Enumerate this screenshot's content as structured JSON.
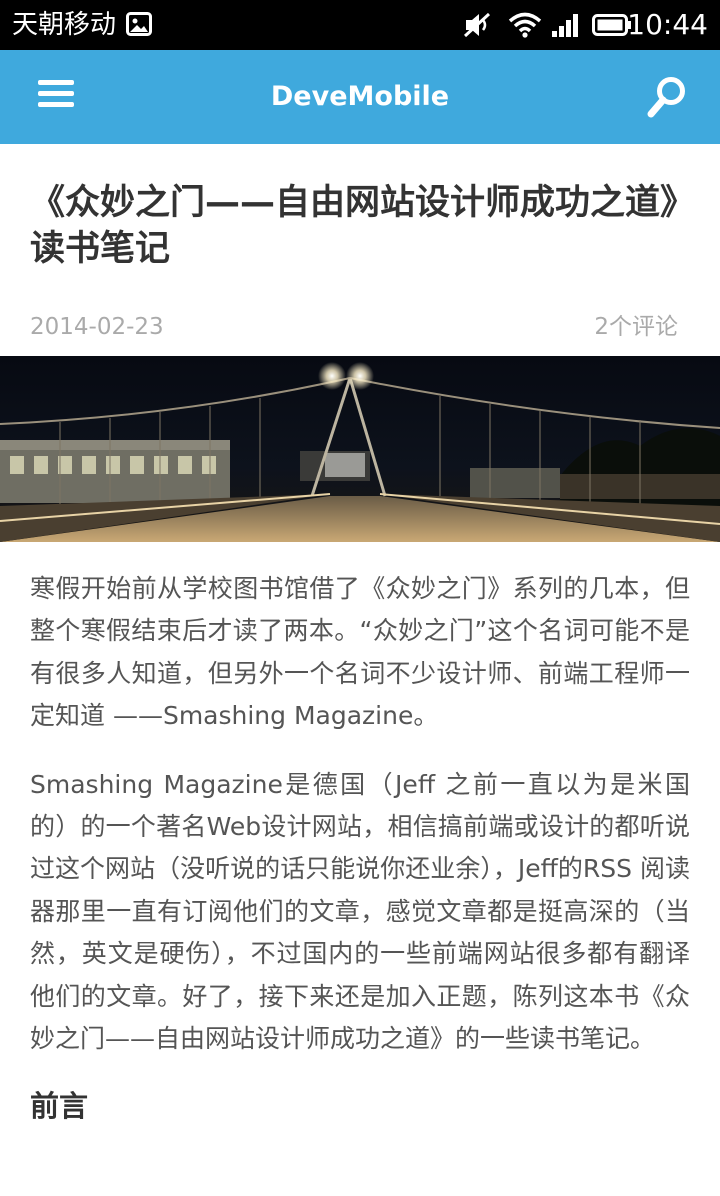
{
  "status_bar": {
    "carrier": "天朝移动",
    "time": "10:44",
    "icons": [
      "image-icon",
      "mute-icon",
      "wifi-icon",
      "signal-icon",
      "battery-icon"
    ]
  },
  "app_bar": {
    "title": "DeveMobile",
    "menu_icon": "menu-icon",
    "search_icon": "search-icon",
    "background": "#3fa9dd"
  },
  "post": {
    "title": "《众妙之门——自由网站设计师成功之道》读书笔记",
    "date": "2014-02-23",
    "comments": "2个评论",
    "paragraphs": [
      "寒假开始前从学校图书馆借了《众妙之门》系列的几本，但整个寒假结束后才读了两本。“众妙之门”这个名词可能不是有很多人知道，但另外一个名词不少设计师、前端工程师一定知道 ——Smashing Magazine。",
      "Smashing Magazine是德国（Jeff 之前一直以为是米国的）的一个著名Web设计网站，相信搞前端或设计的都听说过这个网站（没听说的话只能说你还业余），Jeff的RSS 阅读器那里一直有订阅他们的文章，感觉文章都是挺高深的（当然，英文是硬伤），不过国内的一些前端网站很多都有翻译他们的文章。好了，接下来还是加入正题，陈列这本书《众妙之门——自由网站设计师成功之道》的一些读书笔记。"
    ],
    "section_heading": "前言"
  }
}
